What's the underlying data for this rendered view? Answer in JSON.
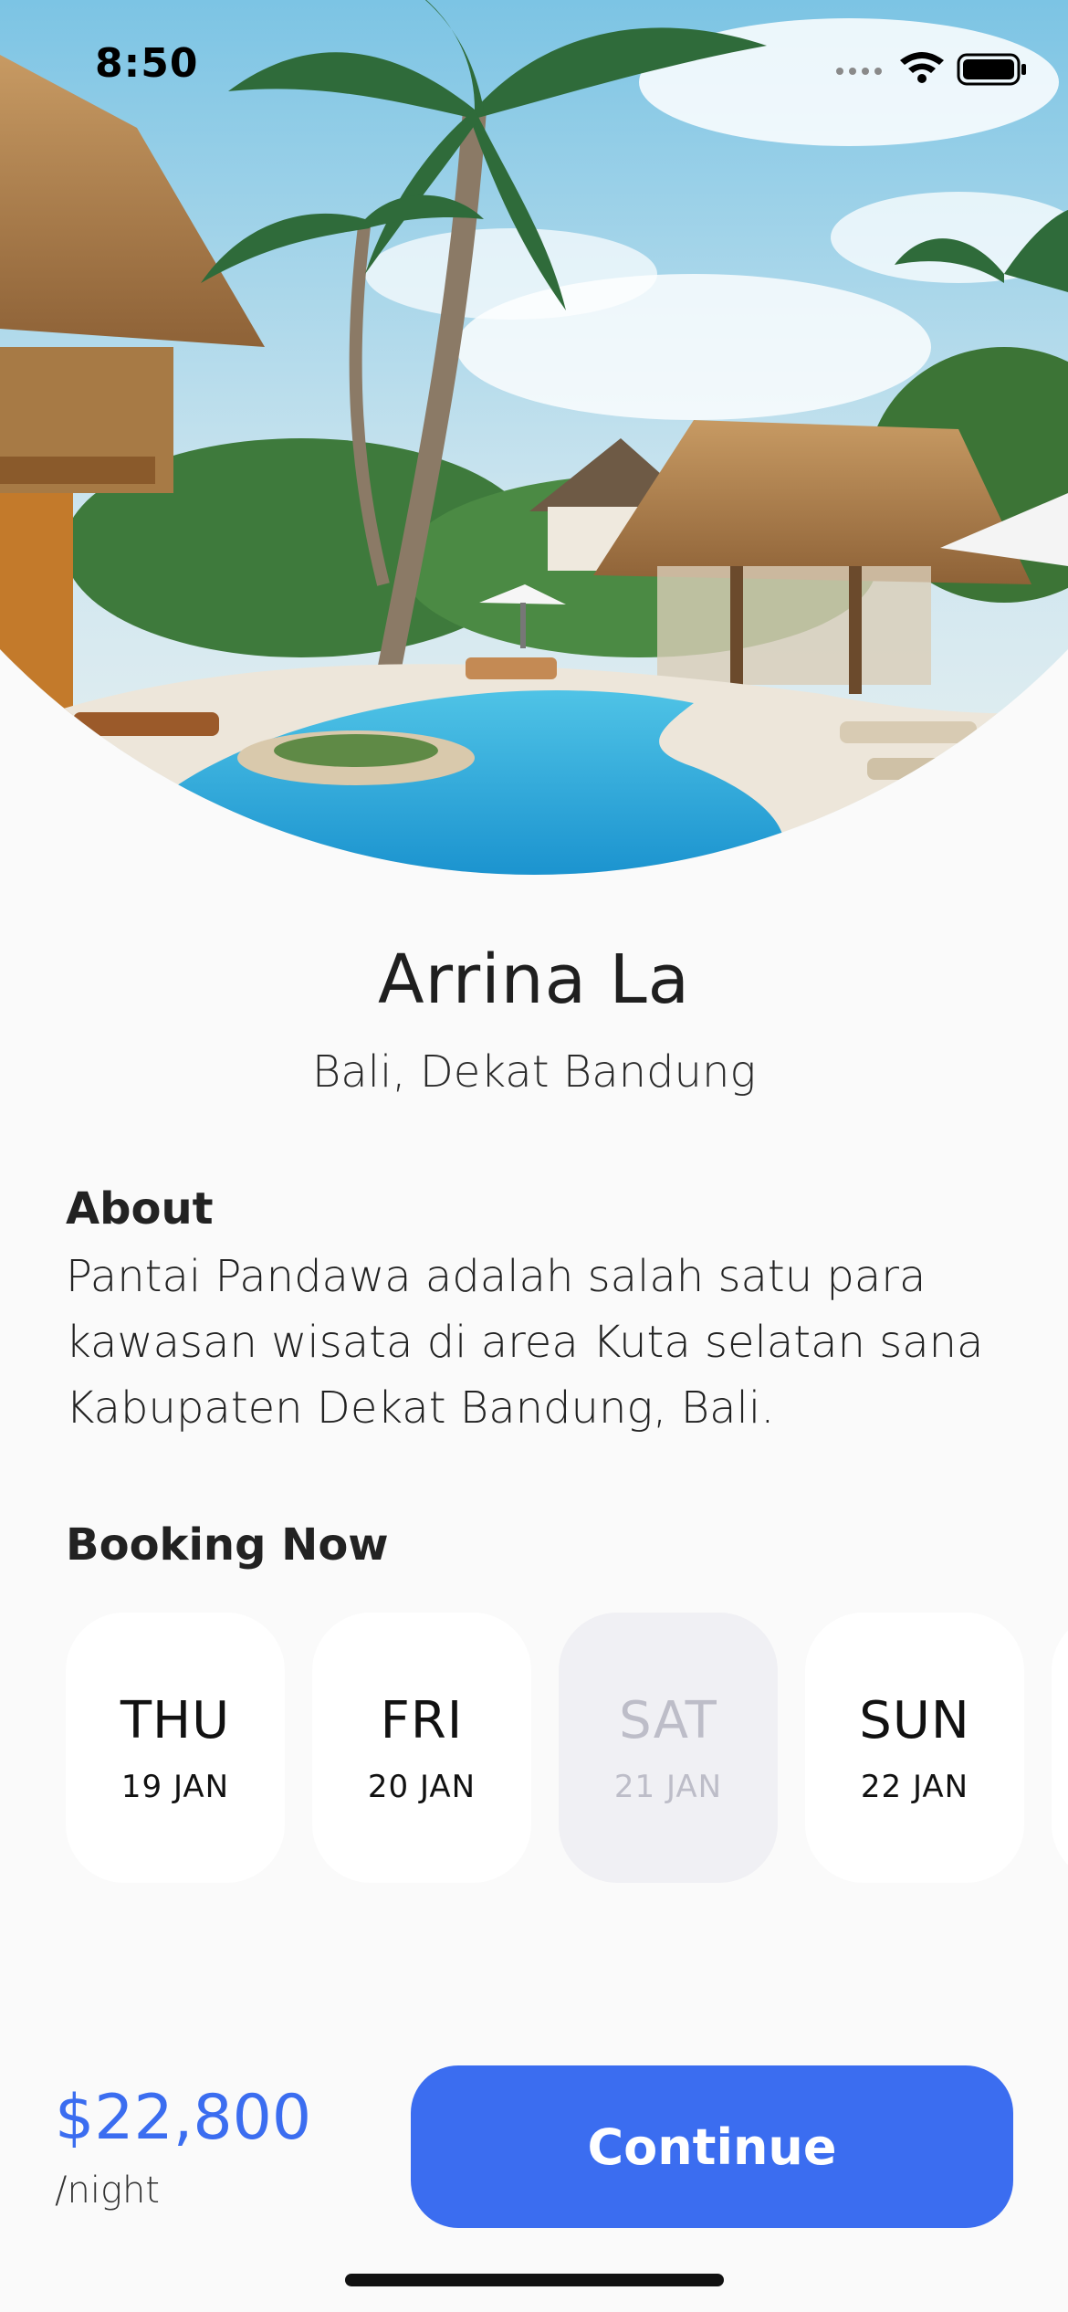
{
  "status_bar": {
    "time": "8:50"
  },
  "place": {
    "name": "Arrina La",
    "location": "Bali, Dekat Bandung"
  },
  "about": {
    "title": "About",
    "text": "Pantai Pandawa adalah salah satu para kawasan wisata di area Kuta selatan sana Kabupaten Dekat Bandung, Bali."
  },
  "booking": {
    "title": "Booking Now",
    "dates": [
      {
        "day": "THU",
        "date": "19 JAN",
        "available": true
      },
      {
        "day": "FRI",
        "date": "20 JAN",
        "available": true
      },
      {
        "day": "SAT",
        "date": "21 JAN",
        "available": false
      },
      {
        "day": "SUN",
        "date": "22 JAN",
        "available": true
      }
    ]
  },
  "footer": {
    "price": "$22,800",
    "unit": "/night",
    "continue_label": "Continue"
  },
  "colors": {
    "accent": "#3b6df0",
    "background": "#fafafa"
  }
}
